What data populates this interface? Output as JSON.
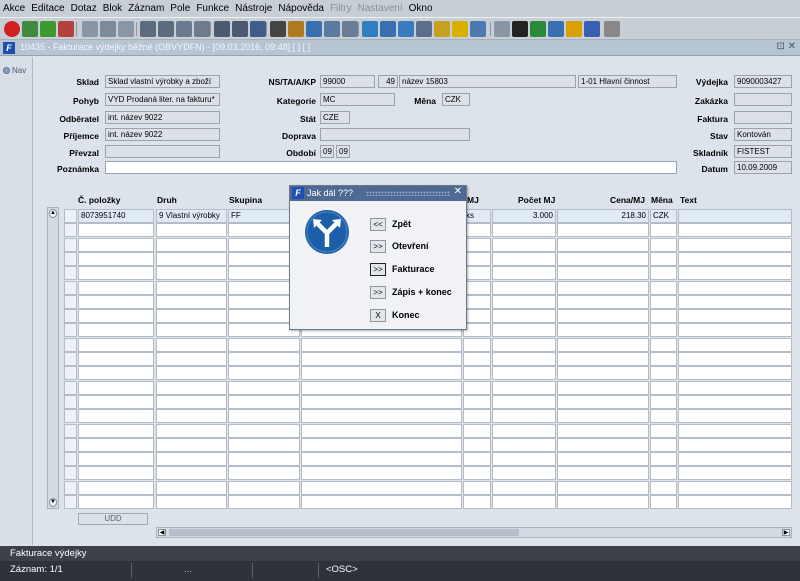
{
  "menu": [
    "Akce",
    "Editace",
    "Dotaz",
    "Blok",
    "Záznam",
    "Pole",
    "Funkce",
    "Nástroje",
    "Nápověda",
    "Filtry",
    "Nastavení",
    "Okno"
  ],
  "menu_disabled": [
    "Filtry",
    "Nastavení"
  ],
  "toolbar_icons": [
    "exit-icon",
    "new-record-icon",
    "save-green-icon",
    "delete-record-icon",
    "copy-icon",
    "paste-icon",
    "cut-icon",
    "sort-asc-icon",
    "sort-desc-icon",
    "query-icon",
    "filter-icon",
    "print-icon",
    "print-preview-icon",
    "mail-icon",
    "cut2-icon",
    "transfer-icon",
    "find-icon",
    "replace-icon",
    "table-icon",
    "calc-icon",
    "export-icon",
    "copy-record-icon",
    "chart-icon",
    "star-icon",
    "warning-icon",
    "window-icon",
    "refresh-icon",
    "sigma-icon",
    "excel-icon",
    "note-icon",
    "help-icon",
    "help2-icon",
    "info-icon"
  ],
  "window": {
    "app_icon": "F",
    "title": "10435 - Fakturace výdejky běžné (OBVYDFN) - [09.03.2016, 09:48]  [ ]  [ ]",
    "controls": "⊡ ✕"
  },
  "nav": {
    "label": "Nav"
  },
  "form": {
    "sklad_label": "Sklad",
    "sklad_value": "Sklad vlastní výrobky a zboží",
    "pohyb_label": "Pohyb",
    "pohyb_value": "VYD Prodaná liter. na fakturu*",
    "odberatel_label": "Odběratel",
    "odberatel_value": "int. název 9022",
    "prijemce_label": "Příjemce",
    "prijemce_value": "int. název 9022",
    "prevzal_label": "Převzal",
    "prevzal_value": "",
    "poznamka_label": "Poznámka",
    "poznamka_value": "",
    "ns_label": "NS/TA/A/KP",
    "ns_value": "99000",
    "ns_code": "49",
    "ns_name": "název 15803",
    "ns_kp": "1-01 Hlavní činnost",
    "kategorie_label": "Kategorie",
    "kategorie_value": "MC",
    "mena_label": "Měna",
    "mena_value": "CZK",
    "stat_label": "Stát",
    "stat_value": "CZE",
    "doprava_label": "Doprava",
    "doprava_value": "",
    "obdobi_label": "Období",
    "obdobi_month": "09",
    "obdobi_year": "09",
    "vydejka_label": "Výdejka",
    "vydejka_value": "9090003427",
    "zakazka_label": "Zakázka",
    "zakazka_value": "",
    "faktura_label": "Faktura",
    "faktura_value": "",
    "stav_label": "Stav",
    "stav_value": "Kontován",
    "skladnik_label": "Skladník",
    "skladnik_value": "FISTEST",
    "datum_label": "Datum",
    "datum_value": "10.09.2009"
  },
  "grid": {
    "headers": {
      "cislo": "Č. položky",
      "druh": "Druh",
      "skupina": "Skupina",
      "mj": "MJ",
      "pocet": "Počet MJ",
      "cena": "Cena/MJ",
      "mena": "Měna",
      "text": "Text"
    },
    "row1": {
      "cislo": "8073951740",
      "druh": "9 Vlastní výrobky",
      "skupina": "FF",
      "mj": "ks",
      "pocet": "3.000",
      "cena": "218.30",
      "mena": "CZK",
      "text": ""
    },
    "footer_button": "UDD"
  },
  "dialog": {
    "title": "Jak dál ???",
    "icon": "direction-arrows-icon",
    "options": [
      {
        "btn": "<<",
        "label": "Zpět"
      },
      {
        "btn": ">>",
        "label": "Otevření"
      },
      {
        "btn": ">>",
        "label": "Fakturace"
      },
      {
        "btn": ">>",
        "label": "Zápis + konec"
      },
      {
        "btn": "X",
        "label": "Konec"
      }
    ]
  },
  "status": {
    "line1": "Fakturace výdejky",
    "record": "Záznam: 1/1",
    "ellipsis": "...",
    "osc": "<OSC>"
  }
}
